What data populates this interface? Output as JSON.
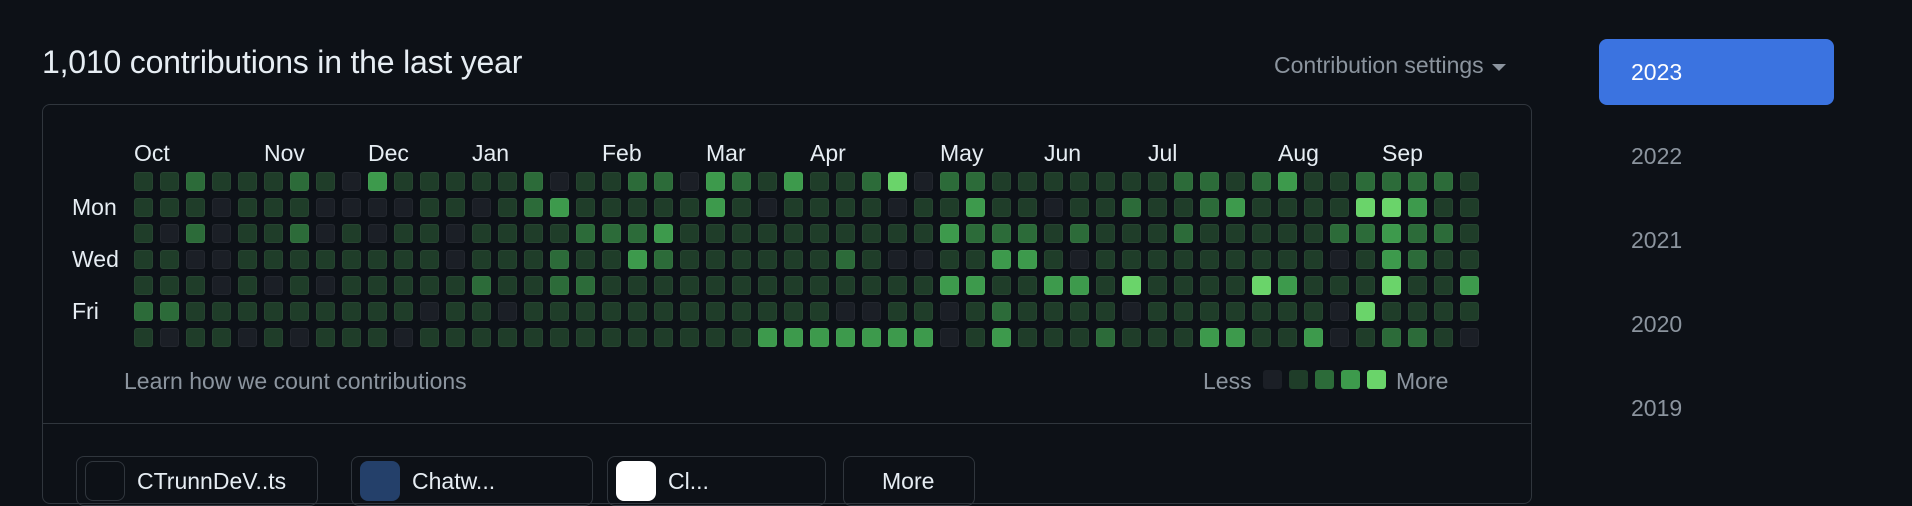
{
  "header": {
    "title": "1,010 contributions in the last year",
    "settings_label": "Contribution settings"
  },
  "graph": {
    "months": [
      {
        "label": "Oct",
        "col": 0
      },
      {
        "label": "Nov",
        "col": 5
      },
      {
        "label": "Dec",
        "col": 9
      },
      {
        "label": "Jan",
        "col": 13
      },
      {
        "label": "Feb",
        "col": 18
      },
      {
        "label": "Mar",
        "col": 22
      },
      {
        "label": "Apr",
        "col": 26
      },
      {
        "label": "May",
        "col": 31
      },
      {
        "label": "Jun",
        "col": 35
      },
      {
        "label": "Jul",
        "col": 39
      },
      {
        "label": "Aug",
        "col": 44
      },
      {
        "label": "Sep",
        "col": 48
      }
    ],
    "day_labels": {
      "mon": "Mon",
      "wed": "Wed",
      "fri": "Fri"
    },
    "level_colors": [
      "#161b22",
      "#0e4429",
      "#006d32",
      "#26a641",
      "#39d353"
    ],
    "display_colors": [
      "#1b1f26",
      "#1f3d29",
      "#2c6b39",
      "#3d9a4c",
      "#6ad46a"
    ],
    "weeks": [
      [
        1,
        1,
        1,
        1,
        1,
        2,
        1
      ],
      [
        1,
        1,
        0,
        1,
        1,
        2,
        0
      ],
      [
        2,
        1,
        2,
        0,
        1,
        1,
        1
      ],
      [
        1,
        0,
        0,
        0,
        0,
        1,
        1
      ],
      [
        1,
        1,
        1,
        1,
        1,
        1,
        0
      ],
      [
        1,
        1,
        1,
        1,
        0,
        1,
        1
      ],
      [
        2,
        1,
        2,
        1,
        1,
        1,
        0
      ],
      [
        1,
        0,
        0,
        1,
        0,
        1,
        1
      ],
      [
        0,
        0,
        1,
        1,
        1,
        1,
        1
      ],
      [
        3,
        0,
        0,
        1,
        1,
        1,
        1
      ],
      [
        1,
        0,
        1,
        1,
        1,
        1,
        0
      ],
      [
        1,
        1,
        1,
        1,
        1,
        0,
        1
      ],
      [
        1,
        1,
        0,
        0,
        1,
        1,
        1
      ],
      [
        1,
        0,
        1,
        1,
        2,
        1,
        1
      ],
      [
        1,
        1,
        1,
        1,
        1,
        0,
        1
      ],
      [
        2,
        2,
        1,
        1,
        1,
        1,
        1
      ],
      [
        0,
        3,
        1,
        2,
        2,
        1,
        1
      ],
      [
        1,
        1,
        2,
        1,
        2,
        1,
        1
      ],
      [
        1,
        1,
        2,
        1,
        1,
        1,
        1
      ],
      [
        2,
        1,
        2,
        3,
        1,
        1,
        1
      ],
      [
        2,
        1,
        3,
        2,
        1,
        1,
        1
      ],
      [
        0,
        1,
        1,
        1,
        1,
        1,
        1
      ],
      [
        3,
        3,
        1,
        1,
        1,
        1,
        1
      ],
      [
        2,
        1,
        1,
        1,
        1,
        1,
        1
      ],
      [
        1,
        0,
        1,
        1,
        1,
        1,
        3
      ],
      [
        3,
        1,
        1,
        1,
        1,
        1,
        3
      ],
      [
        1,
        1,
        1,
        1,
        1,
        1,
        3
      ],
      [
        1,
        1,
        1,
        2,
        1,
        0,
        3
      ],
      [
        2,
        1,
        1,
        1,
        1,
        0,
        3
      ],
      [
        4,
        0,
        1,
        0,
        1,
        1,
        3
      ],
      [
        0,
        1,
        1,
        0,
        1,
        1,
        3
      ],
      [
        2,
        1,
        3,
        1,
        3,
        0,
        0
      ],
      [
        2,
        3,
        2,
        1,
        3,
        1,
        1
      ],
      [
        1,
        1,
        2,
        3,
        1,
        2,
        3
      ],
      [
        1,
        1,
        2,
        3,
        1,
        1,
        1
      ],
      [
        1,
        0,
        1,
        1,
        3,
        1,
        1
      ],
      [
        1,
        1,
        2,
        0,
        3,
        1,
        1
      ],
      [
        1,
        1,
        1,
        1,
        1,
        1,
        2
      ],
      [
        1,
        2,
        1,
        1,
        4,
        0,
        1
      ],
      [
        1,
        1,
        1,
        1,
        1,
        1,
        1
      ],
      [
        2,
        1,
        2,
        1,
        1,
        1,
        1
      ],
      [
        2,
        2,
        1,
        1,
        1,
        1,
        3
      ],
      [
        1,
        3,
        1,
        1,
        1,
        1,
        3
      ],
      [
        2,
        1,
        1,
        1,
        4,
        1,
        1
      ],
      [
        3,
        1,
        1,
        1,
        3,
        1,
        1
      ],
      [
        1,
        1,
        1,
        1,
        1,
        1,
        3
      ],
      [
        1,
        1,
        2,
        0,
        1,
        0,
        0
      ],
      [
        2,
        4,
        2,
        1,
        1,
        4,
        1
      ],
      [
        2,
        4,
        3,
        3,
        4,
        1,
        2
      ],
      [
        2,
        3,
        2,
        2,
        1,
        1,
        2
      ],
      [
        2,
        1,
        2,
        1,
        1,
        1,
        1
      ],
      [
        1,
        1,
        1,
        1,
        3,
        1,
        0
      ]
    ],
    "footer_link": "Learn how we count contributions",
    "legend_less": "Less",
    "legend_more": "More"
  },
  "years": [
    {
      "label": "2023",
      "active": true
    },
    {
      "label": "2022",
      "active": false
    },
    {
      "label": "2021",
      "active": false
    },
    {
      "label": "2020",
      "active": false
    },
    {
      "label": "2019",
      "active": false
    }
  ],
  "activity_chips": [
    {
      "label": "CTrunnDeV..ts"
    },
    {
      "label": "Chatw..."
    },
    {
      "label": "Cl..."
    },
    {
      "label": "More"
    }
  ]
}
